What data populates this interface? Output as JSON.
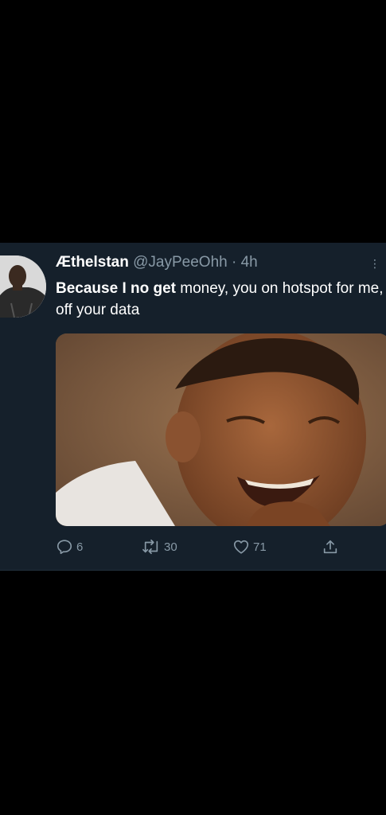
{
  "tweet": {
    "display_name": "Æthelstan",
    "handle": "@JayPeeOhh",
    "separator": "·",
    "time": "4h",
    "text_bold": "Because I no get",
    "text_rest": " money, you on hotspot for me, off your data",
    "media": {
      "description_icon": "photo"
    },
    "actions": {
      "reply_count": "6",
      "retweet_count": "30",
      "like_count": "71"
    }
  },
  "colors": {
    "background": "#15202b",
    "text_primary": "#ffffff",
    "text_secondary": "#8899a6",
    "page": "#000000"
  }
}
